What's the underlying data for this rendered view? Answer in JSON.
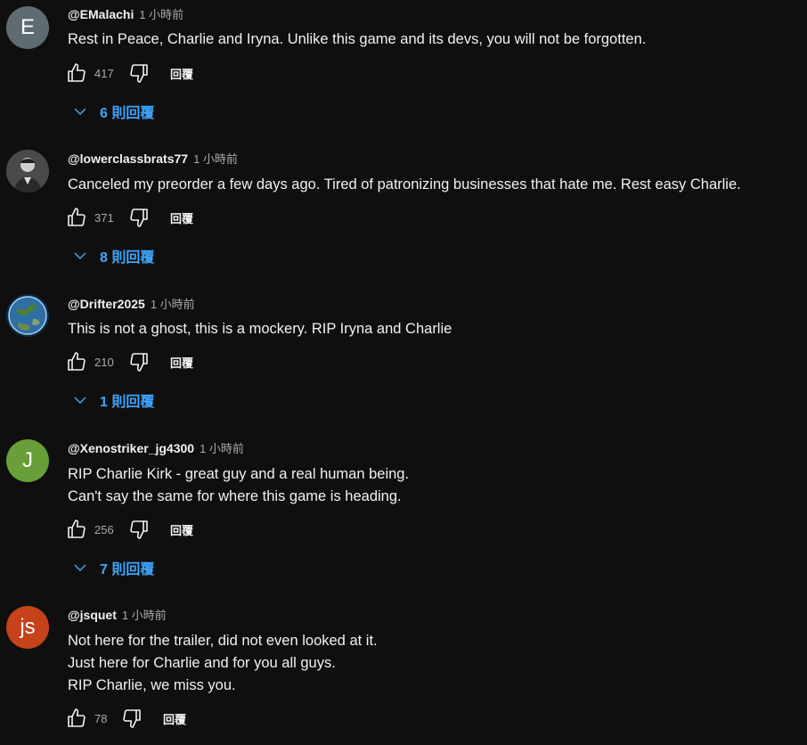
{
  "colors": {
    "background": "#0f0f0f",
    "text": "#f1f1f1",
    "muted": "#aaaaaa",
    "link": "#3ea6ff"
  },
  "comments": [
    {
      "author": "@EMalachi",
      "time": "1 小時前",
      "avatar": {
        "letter": "E",
        "color": "#5f6b73",
        "type": "letter"
      },
      "lines": [
        "Rest in Peace, Charlie and Iryna. Unlike this game and its devs, you will not be forgotten."
      ],
      "likes": "417",
      "reply_label": "回覆",
      "replies_label": "6 則回覆"
    },
    {
      "author": "@lowerclassbrats77",
      "time": "1 小時前",
      "avatar": {
        "letter": "",
        "color": "#3c3c3c",
        "type": "photo-person"
      },
      "lines": [
        "Canceled my preorder a few days ago. Tired of patronizing businesses that hate me. Rest easy Charlie."
      ],
      "likes": "371",
      "reply_label": "回覆",
      "replies_label": "8 則回覆"
    },
    {
      "author": "@Drifter2025",
      "time": "1 小時前",
      "avatar": {
        "letter": "",
        "color": "#1a4f7a",
        "type": "photo-globe"
      },
      "lines": [
        "This is not a ghost, this is a mockery. RIP Iryna and Charlie"
      ],
      "likes": "210",
      "reply_label": "回覆",
      "replies_label": "1 則回覆"
    },
    {
      "author": "@Xenostriker_jg4300",
      "time": "1 小時前",
      "avatar": {
        "letter": "J",
        "color": "#689f38",
        "type": "letter"
      },
      "lines": [
        "RIP Charlie Kirk - great guy and a real human being.",
        "Can't say the same for where this game is heading."
      ],
      "likes": "256",
      "reply_label": "回覆",
      "replies_label": "7 則回覆"
    },
    {
      "author": "@jsquet",
      "time": "1 小時前",
      "avatar": {
        "letter": "js",
        "color": "#c5421a",
        "type": "letter"
      },
      "lines": [
        "Not here for the trailer, did not even looked at it.",
        "Just here for Charlie and for you all guys.",
        "RIP Charlie, we miss you."
      ],
      "likes": "78",
      "reply_label": "回覆",
      "replies_label": ""
    }
  ]
}
